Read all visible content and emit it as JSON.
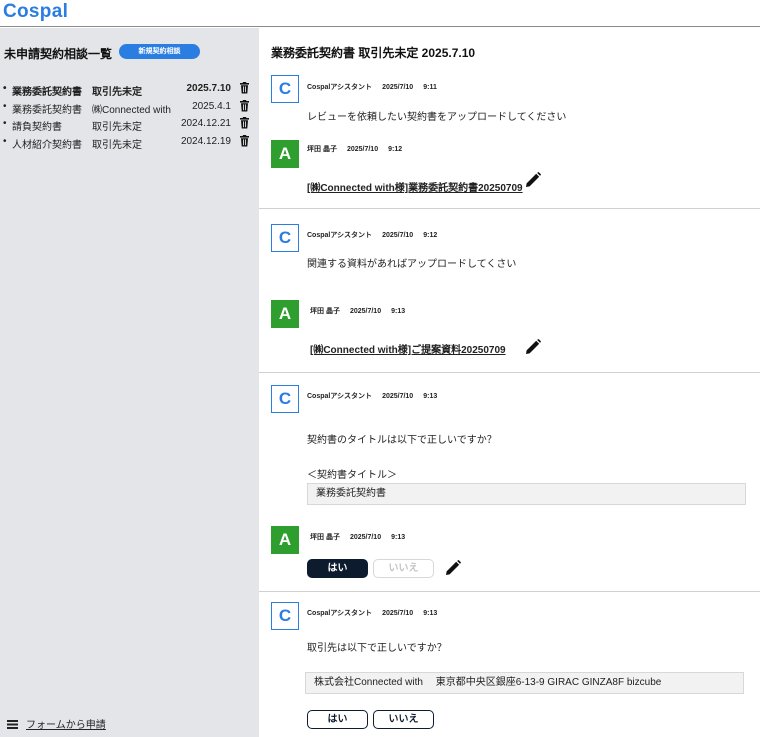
{
  "app": {
    "logo": "Cospal"
  },
  "sidebar": {
    "title": "未申請契約相談一覧",
    "new_button": "新規契約相談",
    "items": [
      {
        "name": "業務委託契約書",
        "party": "取引先未定",
        "date": "2025.7.10",
        "active": true
      },
      {
        "name": "業務委託契約書",
        "party": "㈱Connected with",
        "date": "2025.4.1",
        "active": false
      },
      {
        "name": "請負契約書",
        "party": "取引先未定",
        "date": "2024.12.21",
        "active": false
      },
      {
        "name": "人材紹介契約書",
        "party": "取引先未定",
        "date": "2024.12.19",
        "active": false
      }
    ],
    "bullet": "•",
    "form_link": "フォームから申請"
  },
  "main": {
    "title": "業務委託契約書 取引先未定 2025.7.10",
    "messages": {
      "m1": {
        "avatar": "C",
        "sender": "Cospalアシスタント",
        "date": "2025/7/10",
        "time": "9:11",
        "text": "レビューを依頼したい契約書をアップロードしてください"
      },
      "m2": {
        "avatar": "A",
        "sender": "坪田 晶子",
        "date": "2025/7/10",
        "time": "9:12",
        "file": "[㈱Connected with様]業務委託契約書20250709"
      },
      "m3": {
        "avatar": "C",
        "sender": "Cospalアシスタント",
        "date": "2025/7/10",
        "time": "9:12",
        "text": "関連する資料があればアップロードしてくさい"
      },
      "m4": {
        "avatar": "A",
        "sender": "坪田 晶子",
        "date": "2025/7/10",
        "time": "9:13",
        "file": "[㈱Connected with様]ご提案資料20250709"
      },
      "m5": {
        "avatar": "C",
        "sender": "Cospalアシスタント",
        "date": "2025/7/10",
        "time": "9:13",
        "text": "契約書のタイトルは以下で正しいですか？",
        "label": "＜契約書タイトル＞",
        "value": "業務委託契約書"
      },
      "m6": {
        "avatar": "A",
        "sender": "坪田 晶子",
        "date": "2025/7/10",
        "time": "9:13",
        "yes": "はい",
        "no": "いいえ"
      },
      "m7": {
        "avatar": "C",
        "sender": "Cospalアシスタント",
        "date": "2025/7/10",
        "time": "9:13",
        "text": "取引先は以下で正しいですか？",
        "value": "株式会社Connected with　 東京都中央区銀座6-13-9 GIRAC GINZA8F bizcube",
        "yes": "はい",
        "no": "いいえ"
      }
    }
  },
  "colors": {
    "accent": "#2a7de1",
    "avatar_user": "#2e9e2e",
    "dark_button": "#0d1b2e",
    "sidebar_bg": "#e3e5e8"
  },
  "icons": {
    "trash": "trash-icon",
    "pencil": "pencil-icon",
    "menu": "list-icon"
  }
}
